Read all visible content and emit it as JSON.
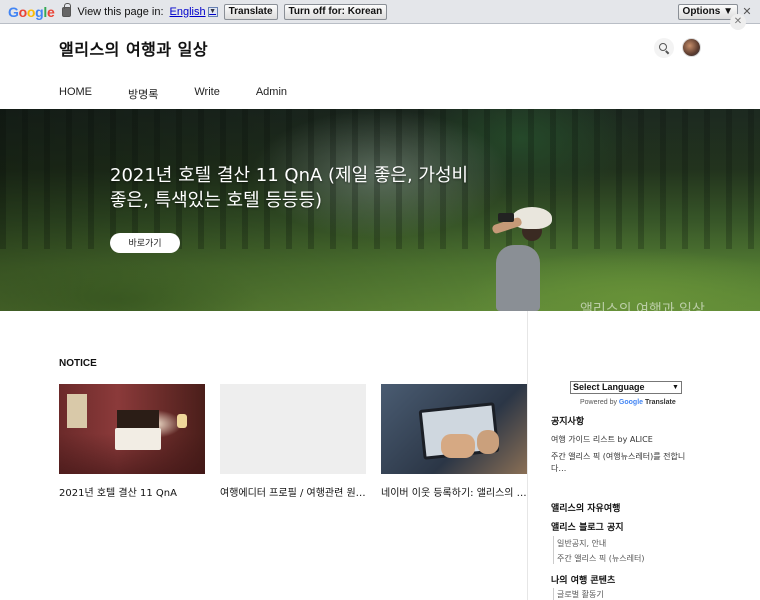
{
  "translate_bar": {
    "logo": "Google",
    "label": "View this page in:",
    "language": "English",
    "language_caret": "▼",
    "translate_button": "Translate",
    "turn_off_button": "Turn off for: Korean",
    "options_button": "Options ▼",
    "close": "✕"
  },
  "blog": {
    "title": "앨리스의 여행과 일상",
    "corner_close": "✕"
  },
  "nav": {
    "items": [
      "HOME",
      "방명록",
      "Write",
      "Admin"
    ]
  },
  "hero": {
    "title": "2021년 호텔 결산 11 QnA (제일 좋은, 가성비 좋은, 특색있는 호텔 등등등)",
    "button": "바로가기",
    "watermark": "앨리스의 여행과 일상"
  },
  "notice": {
    "heading": "NOTICE",
    "cards": [
      {
        "title": "2021년 호텔 결산 11 QnA"
      },
      {
        "title": "여행에디터 프로필 / 여행관련 원…"
      },
      {
        "title": "네이버 이웃 등록하기: 앨리스의 …"
      }
    ]
  },
  "sidebar": {
    "select_language": "Select Language",
    "select_arrow": "▼",
    "powered_by": "Powered by",
    "google": "Google",
    "translate": "Translate",
    "notice_heading": "공지사항",
    "notice_items": [
      "여행 가이드 리스트 by ALICE",
      "주간 앨리스 픽 (여행뉴스레터)를 전합니다…"
    ],
    "category_heading": "앨리스의 자유여행",
    "blog_notice": "앨리스 블로그 공지",
    "blog_notice_items": [
      "일반공지, 안내",
      "주간 앨리스 픽 (뉴스레터)"
    ],
    "my_travel": "나의 여행 콘텐츠",
    "my_travel_items": [
      "글로벌 활동기"
    ]
  }
}
